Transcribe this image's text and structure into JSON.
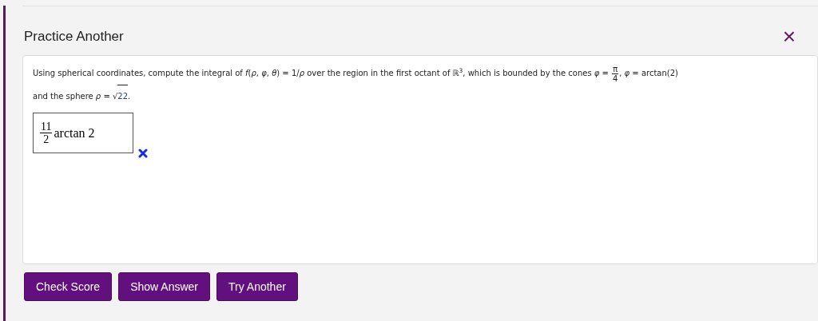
{
  "title": "Practice Another",
  "close": "×",
  "question": {
    "text_before": "Using spherical coordinates, compute the integral of *f*(*ρ*, *φ*, *θ*) = 1/*ρ* over the region in the first octant of ℝ$^{3}$, which is bounded by the cones *φ* = ",
    "fraction": {
      "numerator": "π",
      "denominator": "4"
    },
    "text_after": ", *φ* = arctan(2)",
    "line2_before": "and the sphere *ρ* = ",
    "radical": "√",
    "sqrt": "22",
    "line2_after": "."
  },
  "answer": {
    "numerator": "11",
    "denominator": "2",
    "text": "arctan 2",
    "correct": false
  },
  "buttons": [
    "Check Score",
    "Show Answer",
    "Try Another"
  ]
}
